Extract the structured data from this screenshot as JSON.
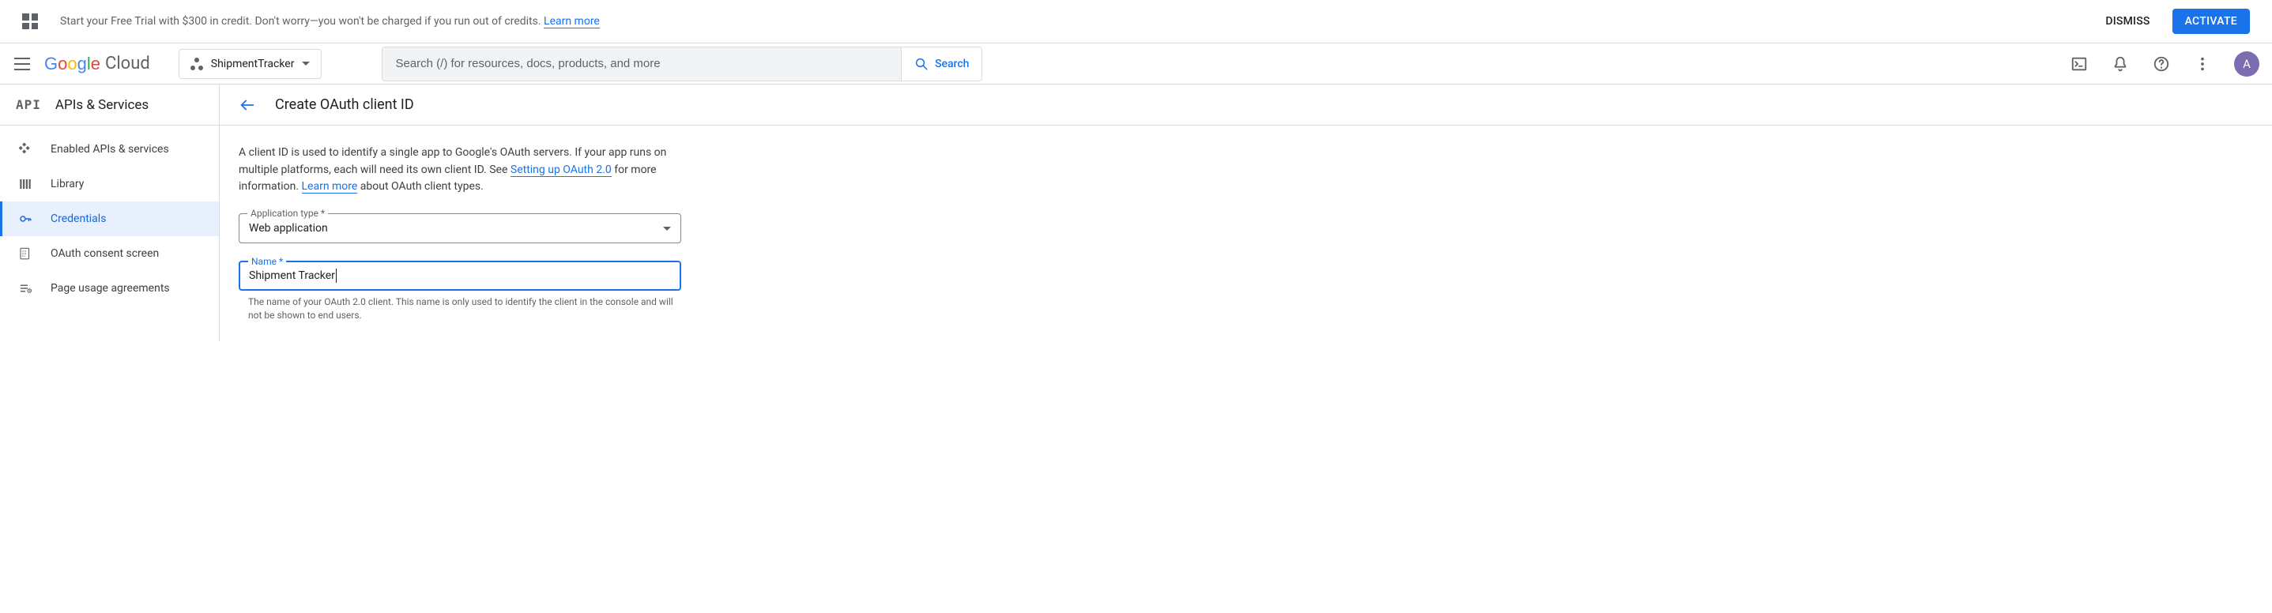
{
  "trial": {
    "text_prefix": "Start your Free Trial with $300 in credit. Don't worry—you won't be charged if you run out of credits. ",
    "learn_more": "Learn more",
    "dismiss": "DISMISS",
    "activate": "ACTIVATE"
  },
  "topbar": {
    "brand_cloud": "Cloud",
    "project_name": "ShipmentTracker",
    "search_placeholder": "Search (/) for resources, docs, products, and more",
    "search_button": "Search",
    "avatar_initial": "A"
  },
  "sidebar": {
    "section_title": "APIs & Services",
    "items": [
      {
        "label": "Enabled APIs & services",
        "icon": "diamond-icon"
      },
      {
        "label": "Library",
        "icon": "library-icon"
      },
      {
        "label": "Credentials",
        "icon": "key-icon",
        "selected": true
      },
      {
        "label": "OAuth consent screen",
        "icon": "consent-icon"
      },
      {
        "label": "Page usage agreements",
        "icon": "agreements-icon"
      }
    ]
  },
  "page": {
    "title": "Create OAuth client ID",
    "description": {
      "pre": "A client ID is used to identify a single app to Google's OAuth servers. If your app runs on multiple platforms, each will need its own client ID. See ",
      "link1": "Setting up OAuth 2.0",
      "mid": " for more information. ",
      "link2": "Learn more",
      "post": " about OAuth client types."
    },
    "app_type": {
      "label": "Application type *",
      "value": "Web application"
    },
    "name_field": {
      "label": "Name *",
      "value": "Shipment Tracker",
      "hint": "The name of your OAuth 2.0 client. This name is only used to identify the client in the console and will not be shown to end users."
    }
  }
}
